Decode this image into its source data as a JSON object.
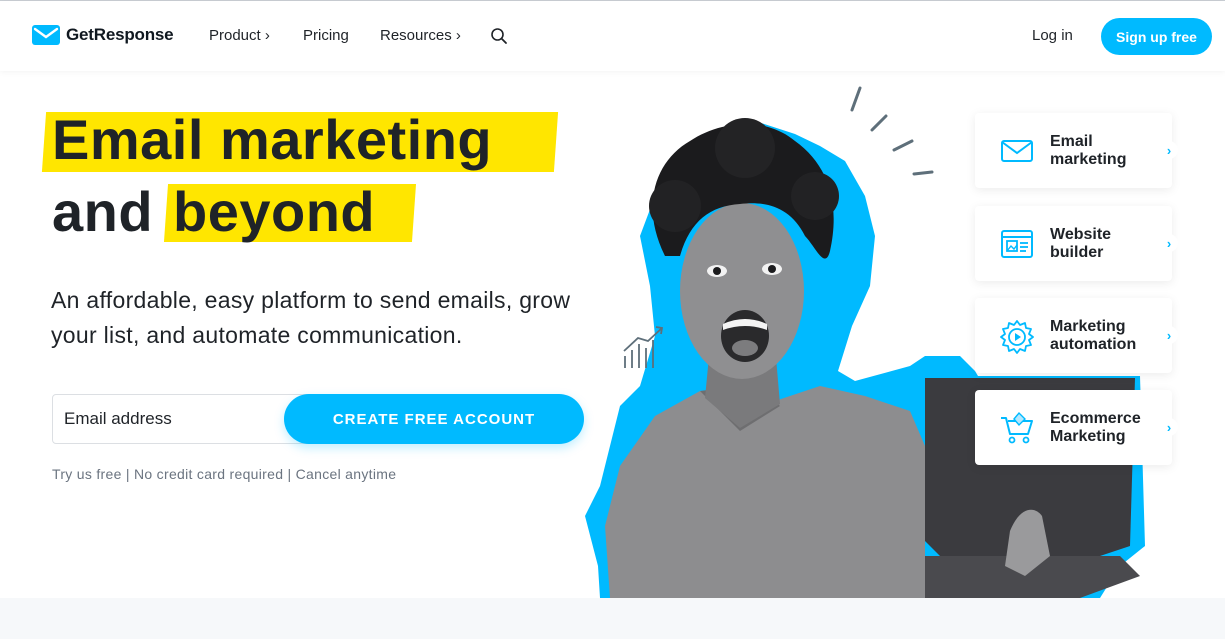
{
  "nav": {
    "logo_text": "GetResponse",
    "items": [
      {
        "label": "Product ›"
      },
      {
        "label": "Pricing"
      },
      {
        "label": "Resources ›"
      }
    ],
    "login": "Log in",
    "signup": "Sign up free"
  },
  "hero": {
    "title_line1": "Email marketing",
    "title_line2a": "and",
    "title_line2b": "beyond",
    "subtitle": "An affordable, easy platform to send emails, grow your list, and automate communication.",
    "email_placeholder": "Email address",
    "cta": "CREATE FREE ACCOUNT",
    "note": "Try us free | No credit card required | Cancel anytime"
  },
  "cards": [
    {
      "label": "Email marketing",
      "icon": "envelope-icon"
    },
    {
      "label": "Website builder",
      "icon": "website-icon"
    },
    {
      "label": "Marketing automation",
      "icon": "automation-gear-icon"
    },
    {
      "label": "Ecommerce Marketing",
      "icon": "cart-icon"
    }
  ],
  "colors": {
    "accent": "#00baff",
    "highlight": "#ffe600",
    "text": "#1f2328"
  }
}
